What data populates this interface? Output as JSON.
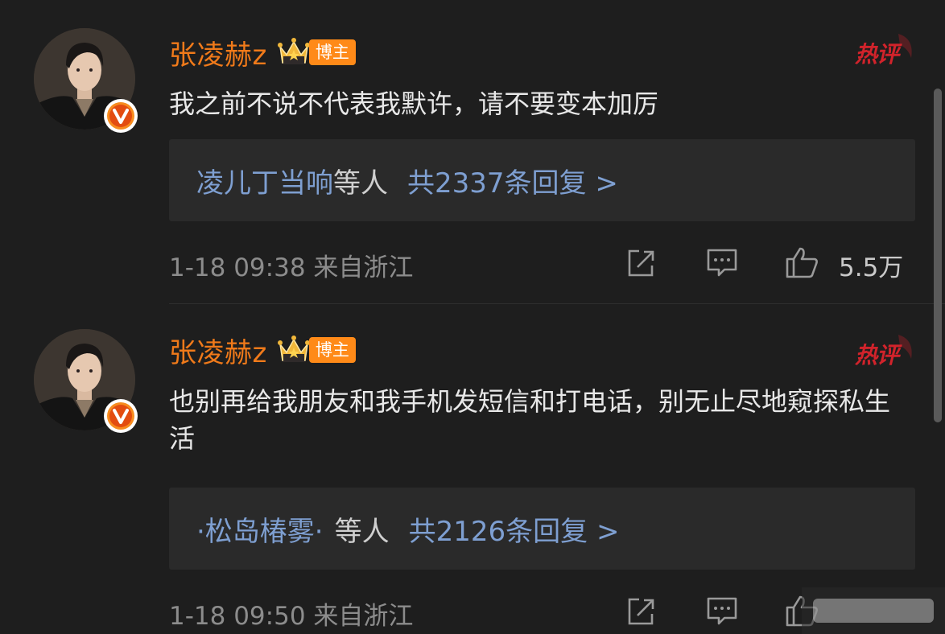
{
  "colors": {
    "background": "#1e1e1e",
    "username": "#f07a1a",
    "badge": "#ff8a18",
    "hot": "#d1232b",
    "link": "#7e9fd1",
    "reply_box": "#2a2a2a"
  },
  "comments": [
    {
      "username": "张凌赫z",
      "role_badge": "博主",
      "hot_label": "热评",
      "text": "我之前不说不代表我默许，请不要变本加厉",
      "reply_users": "凌儿丁当响",
      "reply_mid": "等人",
      "reply_count": "共2337条回复 >",
      "timestamp": "1-18 09:38  来自浙江",
      "like_count": "5.5万",
      "icons": [
        "avatar",
        "verified-v-icon",
        "crown-icon",
        "share-icon",
        "comment-icon",
        "like-icon"
      ]
    },
    {
      "username": "张凌赫z",
      "role_badge": "博主",
      "hot_label": "热评",
      "text": "也别再给我朋友和我手机发短信和打电话，别无止尽地窥探私生活",
      "reply_users": "·松岛椿雾·",
      "reply_mid": "等人",
      "reply_count": "共2126条回复 >",
      "timestamp": "1-18 09:50  来自浙江",
      "like_count": "",
      "icons": [
        "avatar",
        "verified-v-icon",
        "crown-icon",
        "share-icon",
        "comment-icon",
        "like-icon"
      ]
    }
  ]
}
